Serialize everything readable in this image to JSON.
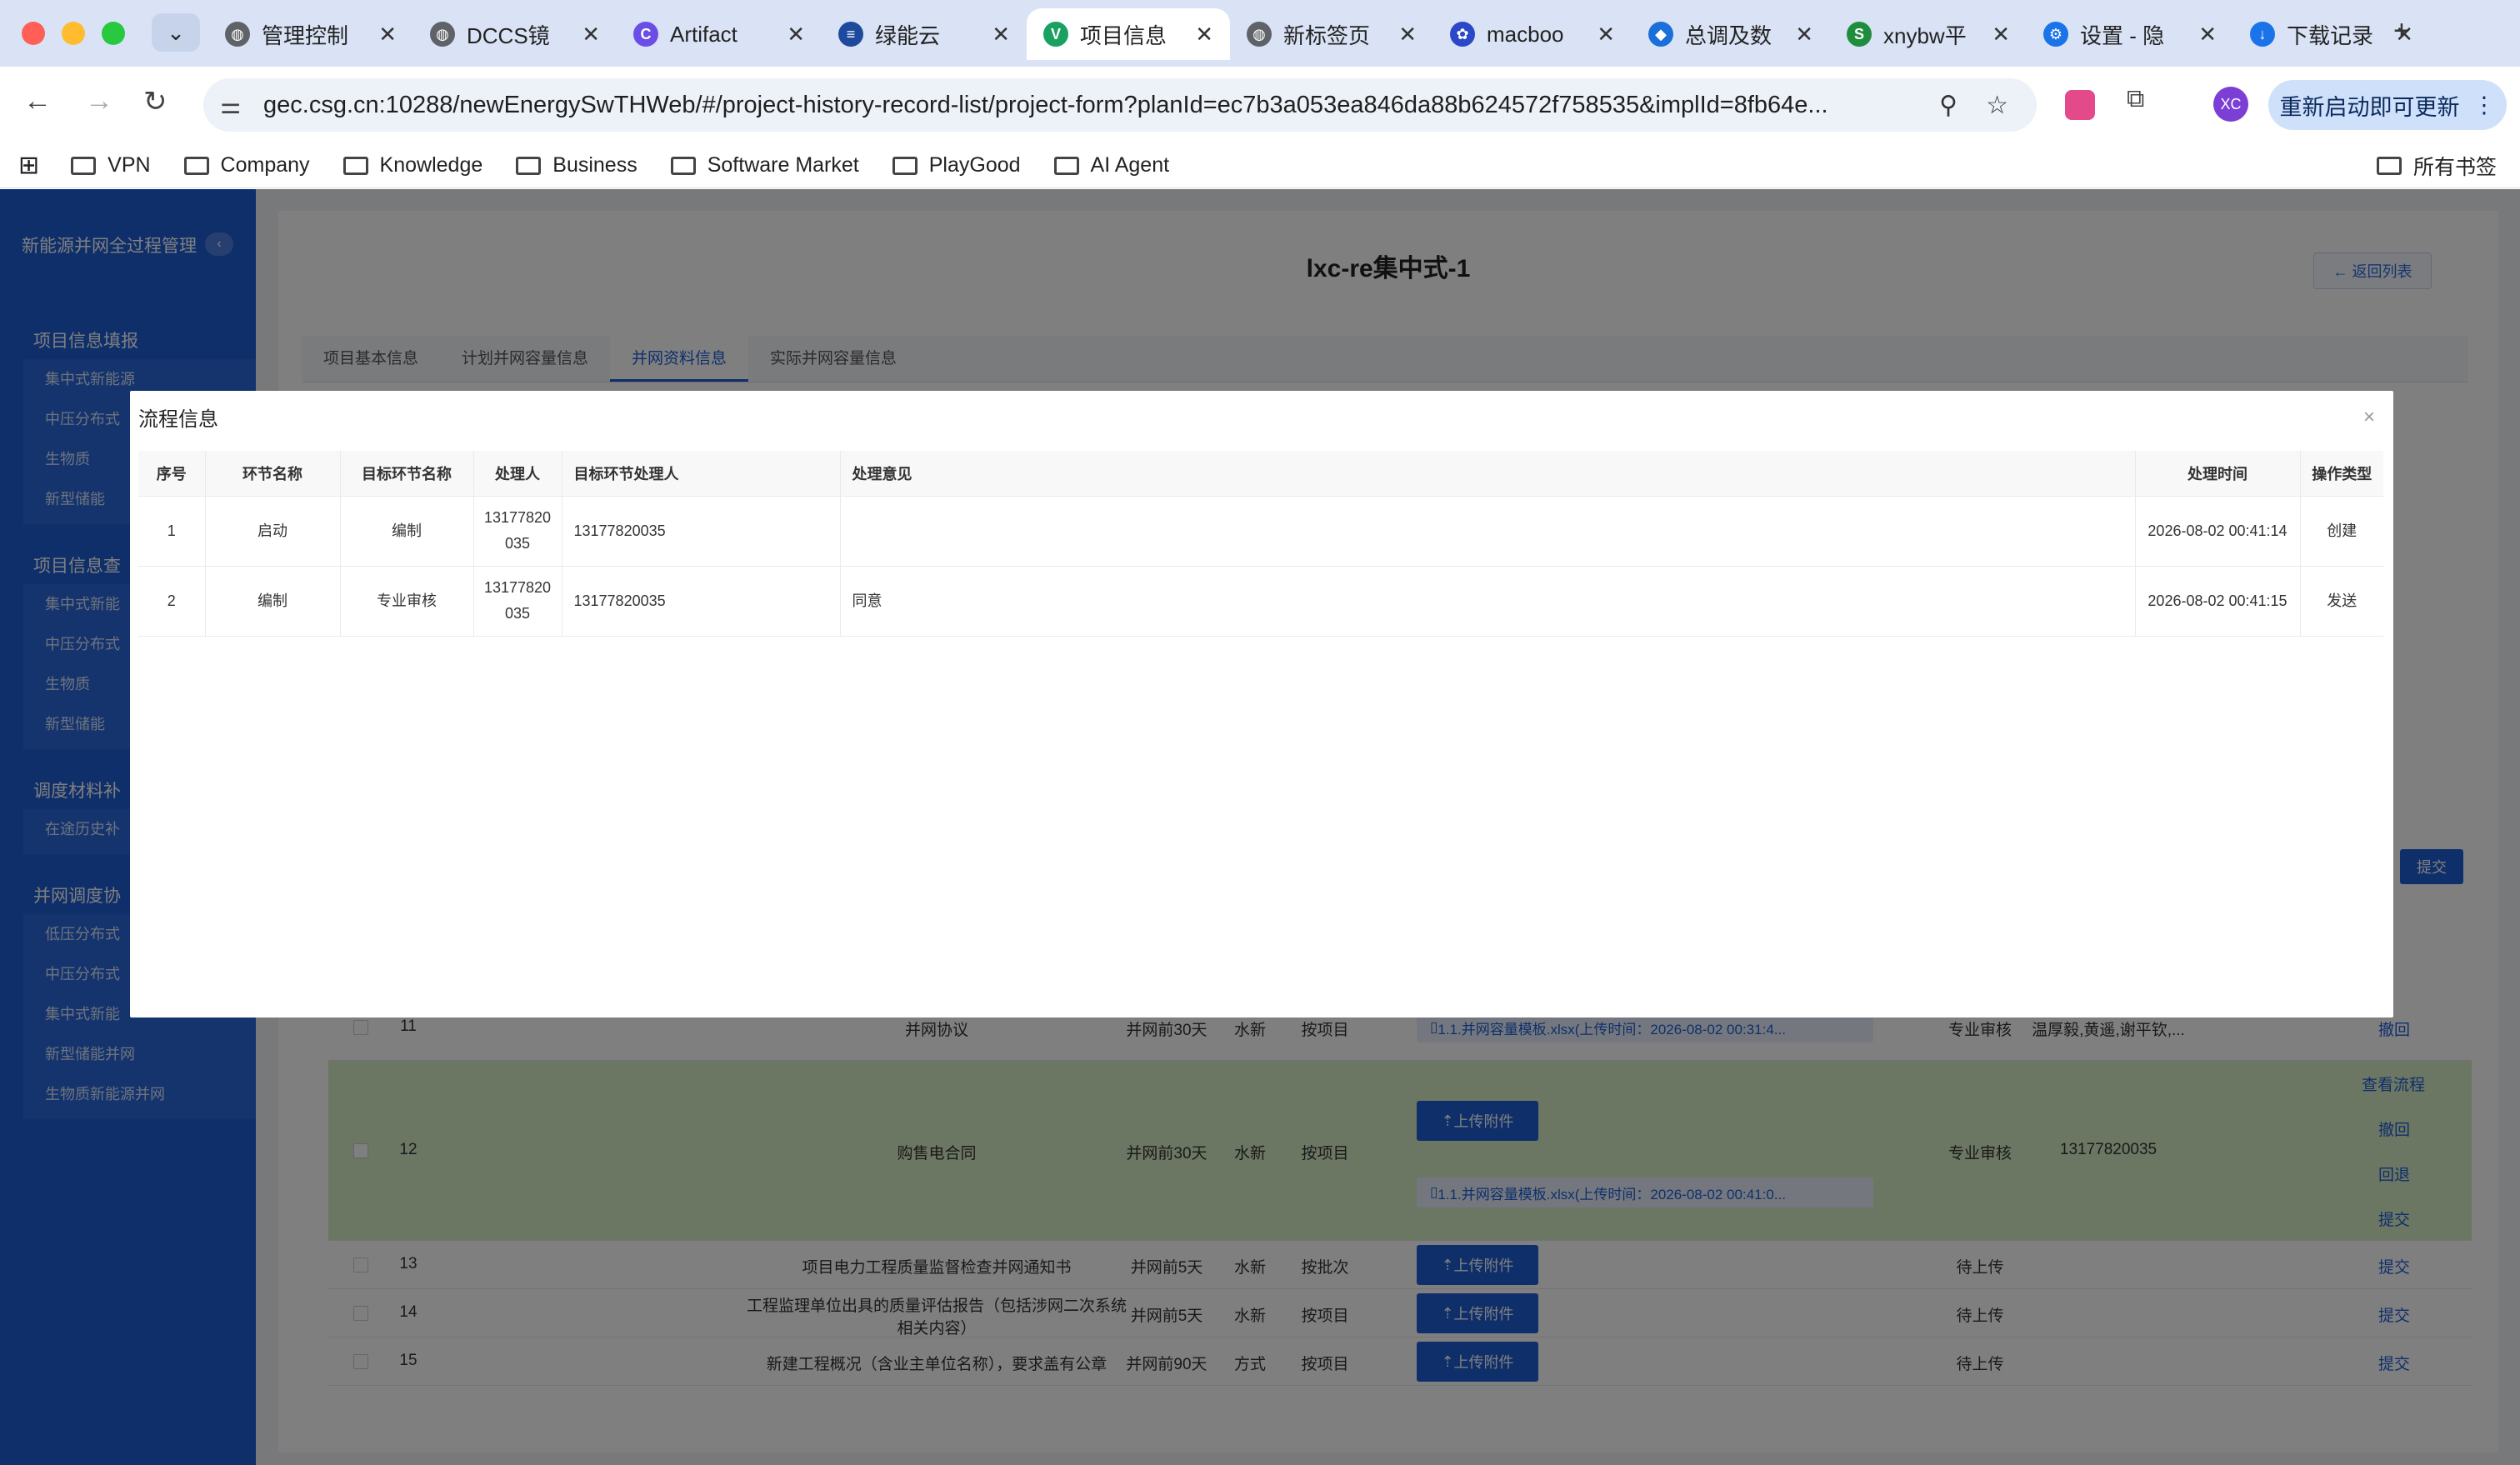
{
  "browser": {
    "tabs": [
      {
        "title": "管理控制",
        "color": "#5f6368",
        "glyph": "◍"
      },
      {
        "title": "DCCS镜",
        "color": "#5f6368",
        "glyph": "◍"
      },
      {
        "title": "Artifact",
        "color": "#6b4ee6",
        "glyph": "C"
      },
      {
        "title": "绿能云",
        "color": "#1e4a9e",
        "glyph": "≡"
      },
      {
        "title": "项目信息",
        "color": "#1aa160",
        "glyph": "V",
        "active": true
      },
      {
        "title": "新标签页",
        "color": "#5f6368",
        "glyph": "◍"
      },
      {
        "title": "macboo",
        "color": "#2a48c8",
        "glyph": "✿"
      },
      {
        "title": "总调及数",
        "color": "#1b6fd8",
        "glyph": "◆"
      },
      {
        "title": "xnybw平",
        "color": "#1e8e3e",
        "glyph": "S"
      },
      {
        "title": "设置 - 隐",
        "color": "#1a73e8",
        "glyph": "⚙"
      },
      {
        "title": "下载记录",
        "color": "#1a73e8",
        "glyph": "↓"
      }
    ],
    "url": "gec.csg.cn:10288/newEnergySwTHWeb/#/project-history-record-list/project-form?planId=ec7b3a053ea846da88b624572f758535&implId=8fb64e...",
    "profile_initials": "XC",
    "update_label": "重新启动即可更新",
    "bookmarks": [
      "VPN",
      "Company",
      "Knowledge",
      "Business",
      "Software Market",
      "PlayGood",
      "AI Agent"
    ],
    "all_bookmarks_label": "所有书签"
  },
  "sidebar": {
    "title": "新能源并网全过程管理",
    "groups": [
      {
        "label": "项目信息填报",
        "items": [
          "集中式新能源",
          "中压分布式",
          "生物质",
          "新型储能"
        ]
      },
      {
        "label": "项目信息查",
        "items": [
          "集中式新能",
          "中压分布式",
          "生物质",
          "新型储能"
        ]
      },
      {
        "label": "调度材料补",
        "items": [
          "在途历史补"
        ]
      },
      {
        "label": "并网调度协",
        "items": [
          "低压分布式",
          "中压分布式",
          "集中式新能",
          "新型储能并网",
          "生物质新能源并网"
        ]
      }
    ]
  },
  "page": {
    "title": "lxc-re集中式-1",
    "back_label": "← 返回列表",
    "tabs": [
      "项目基本信息",
      "计划并网容量信息",
      "并网资料信息",
      "实际并网容量信息"
    ],
    "active_tab": 2,
    "submit_label": "提交"
  },
  "bg_rows": [
    {
      "no": "11",
      "name": "并网协议",
      "period": "并网前30天",
      "kind": "水新",
      "mode": "按项目",
      "file": "1.1.并网容量模板.xlsx(上传时间：2026-08-02 00:31:4...",
      "status": "专业审核",
      "handler": "温厚毅,黄遥,谢平钦,...",
      "ops": [
        "撤回"
      ]
    },
    {
      "no": "12",
      "name": "购售电合同",
      "period": "并网前30天",
      "kind": "水新",
      "mode": "按项目",
      "upload": "上传附件",
      "file": "1.1.并网容量模板.xlsx(上传时间：2026-08-02 00:41:0...",
      "status": "专业审核",
      "handler": "13177820035",
      "ops": [
        "查看流程",
        "撤回",
        "回退",
        "提交"
      ]
    },
    {
      "no": "13",
      "name": "项目电力工程质量监督检查并网通知书",
      "period": "并网前5天",
      "kind": "水新",
      "mode": "按批次",
      "upload": "上传附件",
      "status": "待上传",
      "ops": [
        "提交"
      ]
    },
    {
      "no": "14",
      "name": "工程监理单位出具的质量评估报告（包括涉网二次系统相关内容）",
      "period": "并网前5天",
      "kind": "水新",
      "mode": "按项目",
      "upload": "上传附件",
      "status": "待上传",
      "ops": [
        "提交"
      ]
    },
    {
      "no": "15",
      "name": "新建工程概况（含业主单位名称），要求盖有公章",
      "period": "并网前90天",
      "kind": "方式",
      "mode": "按项目",
      "upload": "上传附件",
      "status": "待上传",
      "ops": [
        "提交"
      ]
    }
  ],
  "modal": {
    "title": "流程信息",
    "close_glyph": "×",
    "headers": [
      "序号",
      "环节名称",
      "目标环节名称",
      "处理人",
      "目标环节处理人",
      "处理意见",
      "处理时间",
      "操作类型"
    ],
    "rows": [
      {
        "seq": "1",
        "step": "启动",
        "target_step": "编制",
        "handler": "13177820035",
        "target_handler": "13177820035",
        "opinion": "",
        "time": "2026-08-02 00:41:14",
        "op_type": "创建"
      },
      {
        "seq": "2",
        "step": "编制",
        "target_step": "专业审核",
        "handler": "13177820035",
        "target_handler": "13177820035",
        "opinion": "同意",
        "time": "2026-08-02 00:41:15",
        "op_type": "发送"
      }
    ]
  },
  "icons": {
    "back": "arrow-left-icon",
    "forward": "arrow-right-icon",
    "reload": "reload-icon",
    "site_info": "tune-icon",
    "zoom": "magnifier-icon",
    "star": "star-icon",
    "translate": "translate-icon",
    "extensions": "puzzle-icon",
    "menu": "kebab-icon",
    "apps": "grid-icon",
    "folder": "folder-icon",
    "close": "close-icon"
  }
}
